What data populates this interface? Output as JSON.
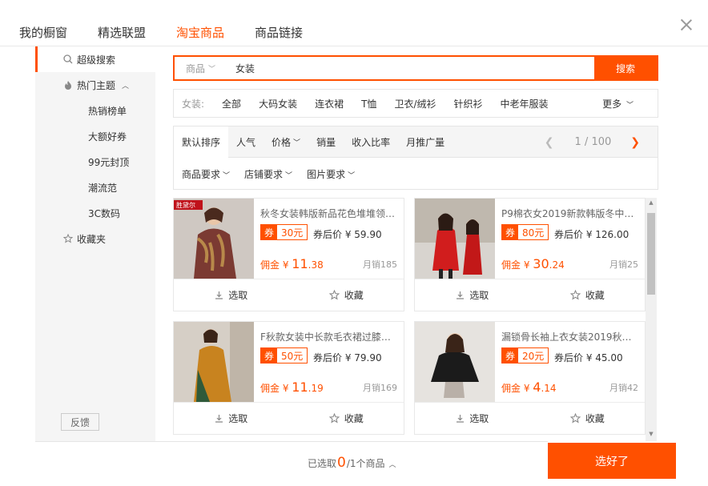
{
  "tabs": [
    "我的橱窗",
    "精选联盟",
    "淘宝商品",
    "商品链接"
  ],
  "sidebar": {
    "super_search": "超级搜索",
    "hot_topics": "热门主题",
    "sub_items": [
      "热销榜单",
      "大额好券",
      "99元封顶",
      "潮流范",
      "3C数码"
    ],
    "favorites": "收藏夹",
    "feedback": "反馈"
  },
  "search": {
    "type": "商品",
    "value": "女装",
    "button": "搜索"
  },
  "categories": {
    "label": "女装:",
    "items": [
      "全部",
      "大码女装",
      "连衣裙",
      "T恤",
      "卫衣/绒衫",
      "针织衫",
      "中老年服装"
    ],
    "more": "更多"
  },
  "sort": {
    "items": [
      "默认排序",
      "人气",
      "价格",
      "销量",
      "收入比率",
      "月推广量"
    ],
    "page": "1 / 100"
  },
  "filters": [
    "商品要求",
    "店铺要求",
    "图片要求"
  ],
  "products": [
    {
      "title": "秋冬女装韩版新品花色堆堆领…",
      "coupon": "30元",
      "after_price": "券后价 ¥ 59.90",
      "commission_prefix": "佣金 ¥ ",
      "commission_int": "11",
      "commission_dec": ".38",
      "sales": "月销185",
      "brand": "胜黛尔",
      "select": "选取",
      "collect": "收藏"
    },
    {
      "title": "P9棉衣女2019新款韩版冬中…",
      "coupon": "80元",
      "after_price": "券后价 ¥ 126.00",
      "commission_prefix": "佣金 ¥ ",
      "commission_int": "30",
      "commission_dec": ".24",
      "sales": "月销25",
      "select": "选取",
      "collect": "收藏"
    },
    {
      "title": "F秋款女装中长款毛衣裙过膝…",
      "coupon": "50元",
      "after_price": "券后价 ¥ 79.90",
      "commission_prefix": "佣金 ¥ ",
      "commission_int": "11",
      "commission_dec": ".19",
      "sales": "月销169",
      "select": "选取",
      "collect": "收藏"
    },
    {
      "title": "漏锁骨长袖上衣女装2019秋…",
      "coupon": "20元",
      "after_price": "券后价 ¥ 45.00",
      "commission_prefix": "佣金 ¥ ",
      "commission_int": "4",
      "commission_dec": ".14",
      "sales": "月销42",
      "select": "选取",
      "collect": "收藏"
    }
  ],
  "coupon_tag": "券",
  "bottom": {
    "selected_prefix": "已选取",
    "selected_count": "0",
    "selected_suffix": "/1个商品",
    "done": "选好了"
  },
  "colors": {
    "accent": "#ff5000"
  }
}
